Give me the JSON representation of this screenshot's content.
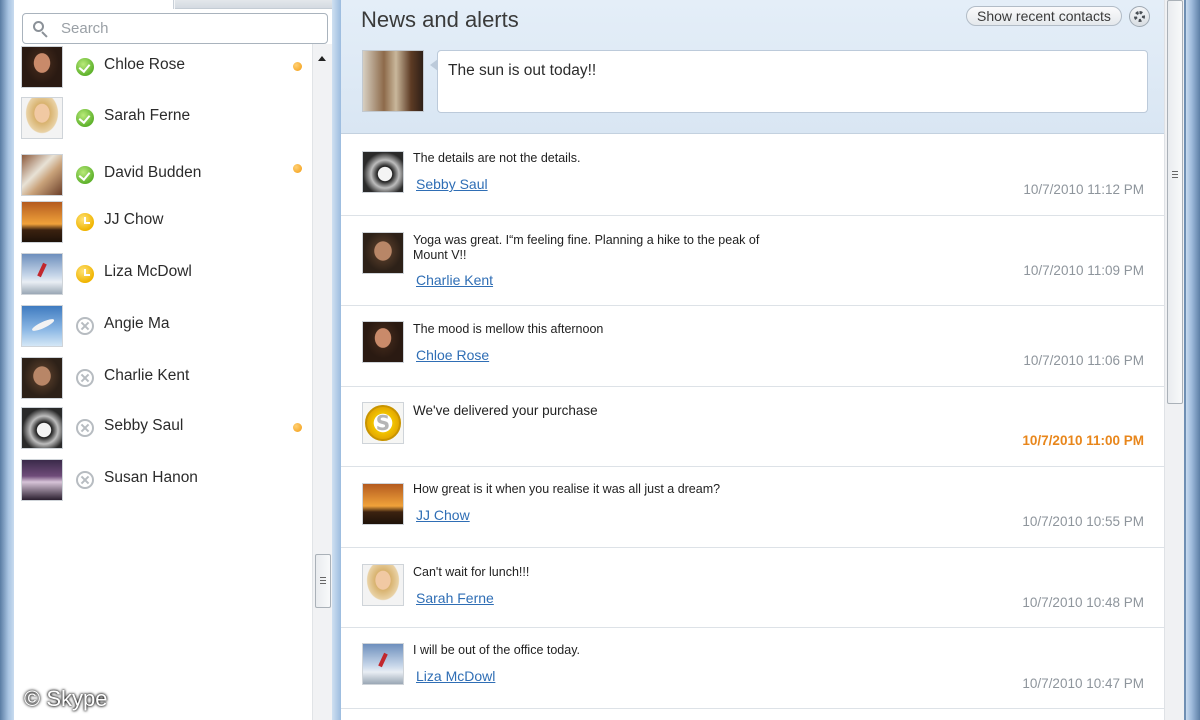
{
  "search": {
    "placeholder": "Search",
    "value": ""
  },
  "contacts": [
    {
      "name": "Chloe Rose",
      "status": "online",
      "has_alert": true,
      "avatar": "woman-dark-hair-photo"
    },
    {
      "name": "Sarah Ferne",
      "status": "online",
      "has_alert": false,
      "avatar": "woman-blonde-photo"
    },
    {
      "name": "David Budden",
      "status": "online",
      "has_alert": true,
      "avatar": "man-in-kitchen-photo"
    },
    {
      "name": "JJ Chow",
      "status": "away",
      "has_alert": false,
      "avatar": "sunset-photo"
    },
    {
      "name": "Liza McDowl",
      "status": "away",
      "has_alert": false,
      "avatar": "snow-skier-photo"
    },
    {
      "name": "Angie Ma",
      "status": "offline",
      "has_alert": false,
      "avatar": "seagull-sky-photo"
    },
    {
      "name": "Charlie Kent",
      "status": "offline",
      "has_alert": false,
      "avatar": "man-smiling-photo"
    },
    {
      "name": "Sebby Saul",
      "status": "offline",
      "has_alert": true,
      "avatar": "guitar-photo"
    },
    {
      "name": "Susan Hanon",
      "status": "offline",
      "has_alert": false,
      "avatar": "concert-crowd-photo"
    }
  ],
  "watermark": "© Skype",
  "news": {
    "title": "News and alerts",
    "recent_contacts_label": "Show recent contacts",
    "mood_message": "The sun is out today!!",
    "items": [
      {
        "text": "The details are not the details.",
        "author": "Sebby Saul",
        "time": "10/7/2010 11:12 PM",
        "highlight": false
      },
      {
        "text": "Yoga was great. I“m feeling fine. Planning a hike to the peak of Mount V!!",
        "author": "Charlie Kent",
        "time": "10/7/2010 11:09 PM",
        "highlight": false
      },
      {
        "text": "The mood is mellow this afternoon",
        "author": "Chloe Rose",
        "time": "10/7/2010 11:06 PM",
        "highlight": false
      },
      {
        "text": "We've delivered your purchase",
        "author": "",
        "time": "10/7/2010 11:00 PM",
        "highlight": true
      },
      {
        "text": "How great is it when you realise it was all just a dream?",
        "author": "JJ Chow",
        "time": "10/7/2010 10:55 PM",
        "highlight": false
      },
      {
        "text": "Can't wait for lunch!!!",
        "author": "Sarah Ferne",
        "time": "10/7/2010 10:48 PM",
        "highlight": false
      },
      {
        "text": "I will be out of the office today.",
        "author": "Liza McDowl",
        "time": "10/7/2010 10:47 PM",
        "highlight": false
      }
    ]
  },
  "colors": {
    "link": "#2f6eb5",
    "highlight_time": "#e8861b",
    "online": "#5fb22c",
    "away": "#f0b400",
    "alert_dot": "#f39c12"
  }
}
